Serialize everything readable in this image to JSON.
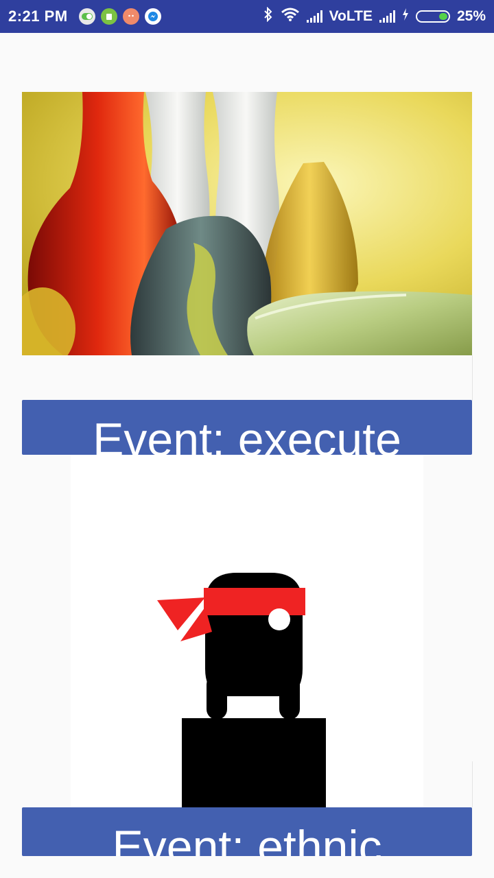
{
  "status_bar": {
    "time": "2:21 PM",
    "network": "VoLTE",
    "battery": "25%",
    "notification_icons": [
      "toggle-icon",
      "android-icon",
      "face-icon",
      "messenger-icon"
    ],
    "status_icons": [
      "bluetooth-icon",
      "wifi-icon",
      "signal-icon",
      "signal-icon",
      "charging-icon",
      "battery-icon"
    ]
  },
  "events": [
    {
      "label": "Event:  execute",
      "image": "glass-vases-photo"
    },
    {
      "label": "Event:  ethnic",
      "image": "ninja-character-illustration"
    }
  ],
  "colors": {
    "status_bar": "#2f3f9e",
    "event_bar": "#4360b0",
    "background": "#fafafa",
    "ninja_band": "#ef2323"
  }
}
